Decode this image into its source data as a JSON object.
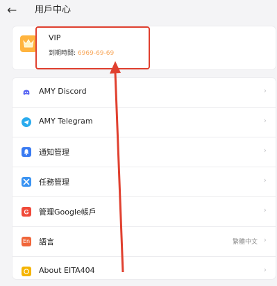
{
  "header": {
    "back_glyph": "←",
    "title": "用戶中心"
  },
  "vip": {
    "title": "VIP",
    "expiry_label": "到期時間:",
    "expiry_date": "6969-69-69",
    "icon": "crown-icon",
    "icon_color": "#ffb43f"
  },
  "menu": {
    "chevron": "›",
    "items": [
      {
        "label": "AMY Discord",
        "icon": "discord-icon",
        "color": "#5865F2"
      },
      {
        "label": "AMY Telegram",
        "icon": "telegram-icon",
        "color": "#2AABEE"
      },
      {
        "label": "通知管理",
        "icon": "bell-icon",
        "color": "#3a7bf2"
      },
      {
        "label": "任務管理",
        "icon": "tools-icon",
        "color": "#3a93f2"
      },
      {
        "label": "管理Google帳戶",
        "icon": "google-g-icon",
        "color": "#f04a3a"
      },
      {
        "label": "語言",
        "icon": "language-en-icon",
        "color": "#f0663a",
        "icon_text": "En",
        "value": "繁體中文"
      },
      {
        "label": "About EITA404",
        "icon": "info-icon",
        "color": "#f5b400"
      }
    ]
  },
  "annotation": {
    "color": "#e0402f"
  }
}
